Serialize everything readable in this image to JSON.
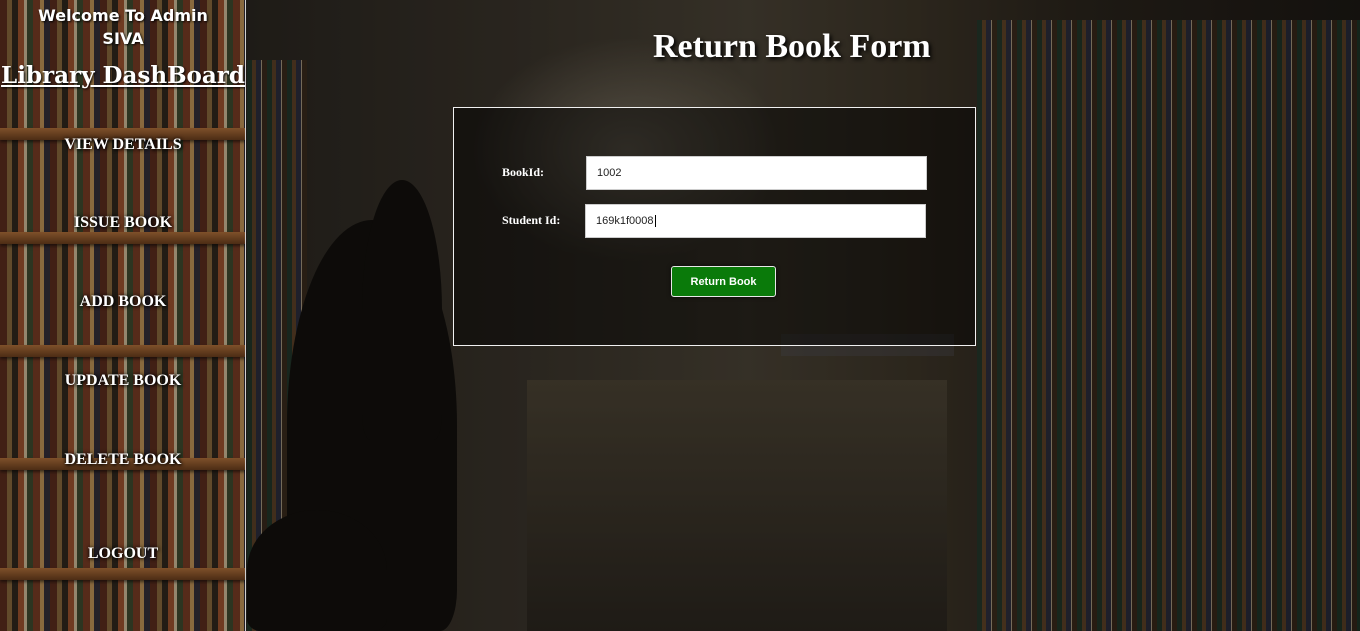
{
  "sidebar": {
    "welcome_line1": "Welcome To Admin",
    "welcome_line2": "SIVA",
    "title": "Library DashBoard",
    "items": [
      {
        "label": "VIEW DETAILS"
      },
      {
        "label": "ISSUE BOOK"
      },
      {
        "label": "ADD BOOK"
      },
      {
        "label": "UPDATE BOOK"
      },
      {
        "label": "DELETE BOOK"
      },
      {
        "label": "LOGOUT"
      }
    ]
  },
  "form": {
    "title": "Return Book Form",
    "book_id_label": "BookId:",
    "book_id_value": "1002",
    "student_id_label": "Student Id:",
    "student_id_value": "169k1f0008",
    "submit_label": "Return Book"
  },
  "colors": {
    "button_green": "#0a7a0a",
    "text": "#ffffff"
  }
}
